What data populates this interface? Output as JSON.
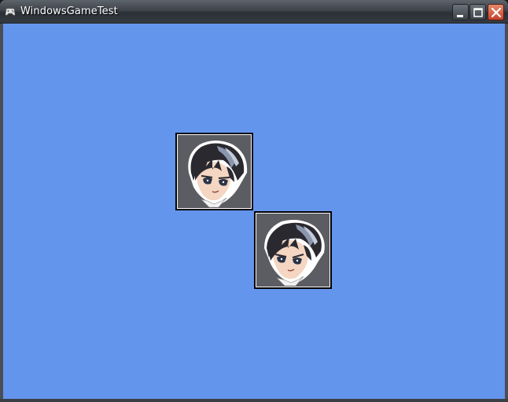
{
  "window": {
    "title": "WindowsGameTest",
    "controls": [
      "minimize",
      "maximize",
      "close"
    ]
  },
  "colors": {
    "clear_color": "#6495ed",
    "titlebar": "#3f444b",
    "close_button": "#c4432a"
  },
  "scene": {
    "sprites": [
      {
        "name": "character-sprite-1",
        "icon": "anime-character-portrait"
      },
      {
        "name": "character-sprite-2",
        "icon": "anime-character-portrait"
      }
    ]
  }
}
